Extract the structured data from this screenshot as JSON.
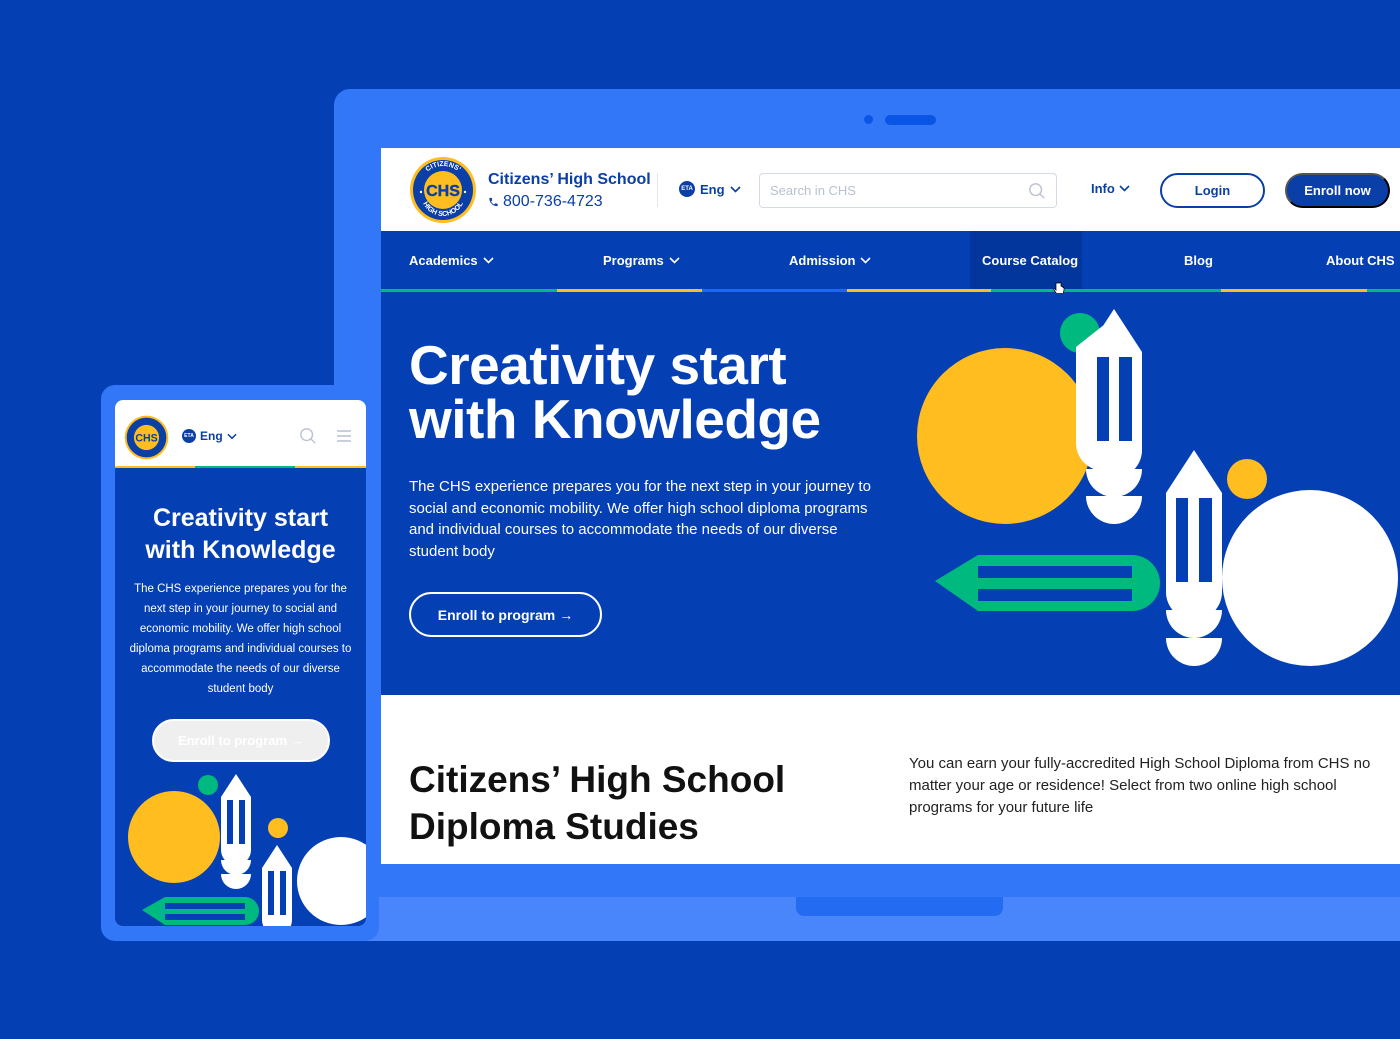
{
  "colors": {
    "background": "#043fb3",
    "device_frame": "#3177f8",
    "brand_blue": "#0a3fa8",
    "accent_yellow": "#ffbd20",
    "accent_green": "#00b97e",
    "nav_active": "#03369d"
  },
  "desktop": {
    "header": {
      "brand_name": "Citizens’ High School",
      "phone": "800-736-4723",
      "language": "Eng",
      "search_placeholder": "Search in CHS",
      "info_label": "Info",
      "login_label": "Login",
      "enroll_label": "Enroll now"
    },
    "nav": {
      "items": [
        {
          "label": "Academics",
          "has_dropdown": true
        },
        {
          "label": "Programs",
          "has_dropdown": true
        },
        {
          "label": "Admission",
          "has_dropdown": true
        },
        {
          "label": "Course Catalog",
          "has_dropdown": false,
          "active": true
        },
        {
          "label": "Blog",
          "has_dropdown": false
        },
        {
          "label": "About CHS",
          "has_dropdown": false
        }
      ]
    },
    "hero": {
      "title_line1": "Creativity start",
      "title_line2": "with Knowledge",
      "description": "The CHS experience prepares you for the next step in your journey to social and economic mobility. We offer  high school diploma programs and individual courses to accommodate the needs of our diverse student body",
      "cta_label": "Enroll to program"
    },
    "studies": {
      "title_line1": "Citizens’ High School",
      "title_line2": "Diploma Studies",
      "description": "You can earn your fully-accredited High School Diploma from CHS no matter your age or residence! Select from two online high school programs for your future life"
    }
  },
  "mobile": {
    "header": {
      "language": "Eng"
    },
    "hero": {
      "title_line1": "Creativity start",
      "title_line2": "with Knowledge",
      "description": "The CHS experience prepares you for the next step in your journey to social and economic mobility. We offer  high school diploma programs and individual courses to accommodate the needs of our diverse student body",
      "cta_label": "Enroll to program"
    }
  },
  "logo": {
    "top_text": "CITIZENS'",
    "center_text": "CHS",
    "bottom_text": "HIGH SCHOOL"
  },
  "icons": {
    "arrow": "→",
    "phone": "phone-icon",
    "globe": "globe-icon",
    "search": "search-icon",
    "chevron": "chevron-down-icon",
    "menu": "hamburger-icon"
  }
}
